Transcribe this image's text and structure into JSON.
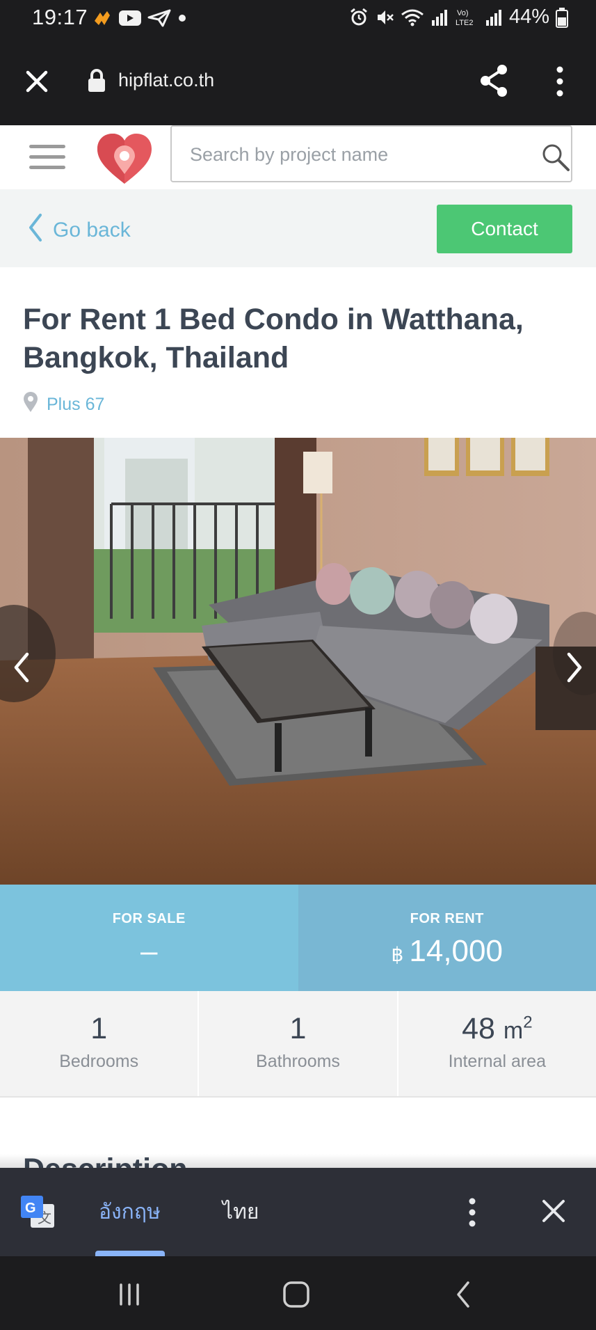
{
  "status_bar": {
    "time": "19:17",
    "battery": "44%",
    "left_icons": [
      "app-notification-icon",
      "youtube-icon",
      "telegram-icon",
      "dot-icon"
    ],
    "right_icons": [
      "alarm-icon",
      "mute-icon",
      "wifi-icon",
      "signal-icon",
      "volte-icon",
      "signal-icon"
    ]
  },
  "browser": {
    "url": "hipflat.co.th"
  },
  "header": {
    "search_placeholder": "Search by project name"
  },
  "subheader": {
    "back_label": "Go back",
    "contact_label": "Contact"
  },
  "listing": {
    "title": "For Rent 1 Bed Condo in Watthana, Bangkok, Thailand",
    "project": "Plus 67"
  },
  "pricing": {
    "sale_label": "FOR SALE",
    "sale_value": "–",
    "rent_label": "FOR RENT",
    "rent_currency": "฿",
    "rent_value": "14,000"
  },
  "stats": [
    {
      "value": "1",
      "caption": "Bedrooms"
    },
    {
      "value": "1",
      "caption": "Bathrooms"
    },
    {
      "value": "48",
      "unit": "m",
      "unit_sup": "2",
      "caption": "Internal area"
    }
  ],
  "description_heading": "Description",
  "translate_bar": {
    "lang_active": "อังกฤษ",
    "lang_other": "ไทย"
  },
  "colors": {
    "accent_blue": "#6ab6d8",
    "contact_green": "#4cc774",
    "sale_band": "#7cc3dd",
    "rent_band": "#79b7d3",
    "title_text": "#3c4654"
  }
}
